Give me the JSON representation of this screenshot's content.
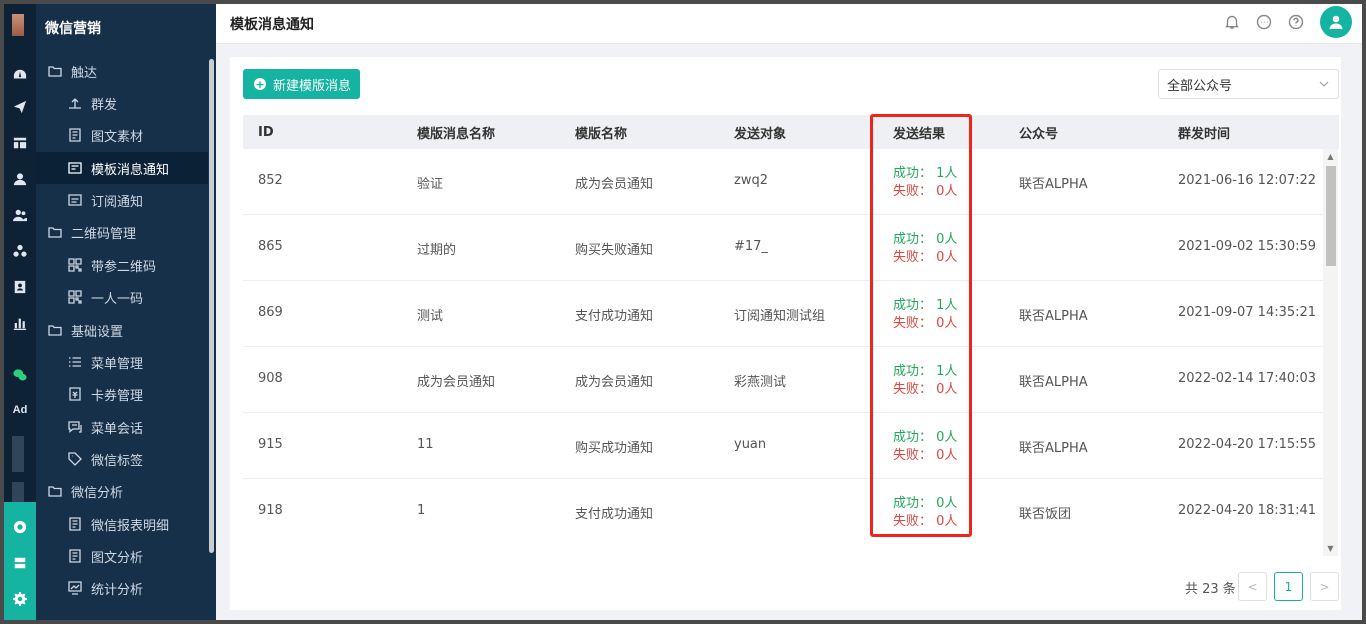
{
  "app": {
    "title": "微信营销"
  },
  "header": {
    "page_title": "模板消息通知"
  },
  "rail": {
    "ad_label": "Ad"
  },
  "sidebar": {
    "items": [
      {
        "label": "触达",
        "type": "group",
        "icon": "folder-icon"
      },
      {
        "label": "群发",
        "type": "sub",
        "icon": "broadcast-icon"
      },
      {
        "label": "图文素材",
        "type": "sub",
        "icon": "article-icon"
      },
      {
        "label": "模板消息通知",
        "type": "sub",
        "icon": "template-icon",
        "active": true
      },
      {
        "label": "订阅通知",
        "type": "sub",
        "icon": "subscribe-icon"
      },
      {
        "label": "二维码管理",
        "type": "group",
        "icon": "folder-icon"
      },
      {
        "label": "带参二维码",
        "type": "sub",
        "icon": "qrcode-icon"
      },
      {
        "label": "一人一码",
        "type": "sub",
        "icon": "qrcode-icon"
      },
      {
        "label": "基础设置",
        "type": "group",
        "icon": "folder-icon"
      },
      {
        "label": "菜单管理",
        "type": "sub",
        "icon": "menu-icon"
      },
      {
        "label": "卡券管理",
        "type": "sub",
        "icon": "coupon-icon"
      },
      {
        "label": "菜单会话",
        "type": "sub",
        "icon": "chat-icon"
      },
      {
        "label": "微信标签",
        "type": "sub",
        "icon": "tag-icon"
      },
      {
        "label": "微信分析",
        "type": "group",
        "icon": "folder-icon"
      },
      {
        "label": "微信报表明细",
        "type": "sub",
        "icon": "report-icon"
      },
      {
        "label": "图文分析",
        "type": "sub",
        "icon": "article-icon"
      },
      {
        "label": "统计分析",
        "type": "sub",
        "icon": "stats-icon"
      }
    ]
  },
  "toolbar": {
    "new_button": "新建模版消息",
    "account_select": "全部公众号"
  },
  "table": {
    "columns": [
      "ID",
      "模版消息名称",
      "模版名称",
      "发送对象",
      "发送结果",
      "公众号",
      "群发时间"
    ],
    "success_label": "成功：",
    "fail_label": "失败：",
    "rows": [
      {
        "id": "852",
        "name": "验证",
        "template": "成为会员通知",
        "target": "zwq2",
        "success": "1人",
        "fail": "0人",
        "account": "联否ALPHA",
        "time": "2021-06-16 12:07:22"
      },
      {
        "id": "865",
        "name": "过期的",
        "template": "购买失败通知",
        "target": "#17_",
        "success": "0人",
        "fail": "0人",
        "account": "",
        "time": "2021-09-02 15:30:59"
      },
      {
        "id": "869",
        "name": "测试",
        "template": "支付成功通知",
        "target": "订阅通知测试组",
        "success": "1人",
        "fail": "0人",
        "account": "联否ALPHA",
        "time": "2021-09-07 14:35:21"
      },
      {
        "id": "908",
        "name": "成为会员通知",
        "template": "成为会员通知",
        "target": "彩燕测试",
        "success": "1人",
        "fail": "0人",
        "account": "联否ALPHA",
        "time": "2022-02-14 17:40:03"
      },
      {
        "id": "915",
        "name": "11",
        "template": "购买成功通知",
        "target": "yuan",
        "success": "0人",
        "fail": "0人",
        "account": "联否ALPHA",
        "time": "2022-04-20 17:15:55"
      },
      {
        "id": "918",
        "name": "1",
        "template": "支付成功通知",
        "target": "",
        "success": "0人",
        "fail": "0人",
        "account": "联否饭团",
        "time": "2022-04-20 18:31:41"
      }
    ]
  },
  "pagination": {
    "total": "共 23 条",
    "prev": "<",
    "current": "1",
    "next": ">"
  },
  "colors": {
    "accent": "#14b3a2",
    "sidebar": "#16304a",
    "success": "#22a85b",
    "fail": "#e0463c",
    "highlight": "#f2221c"
  }
}
